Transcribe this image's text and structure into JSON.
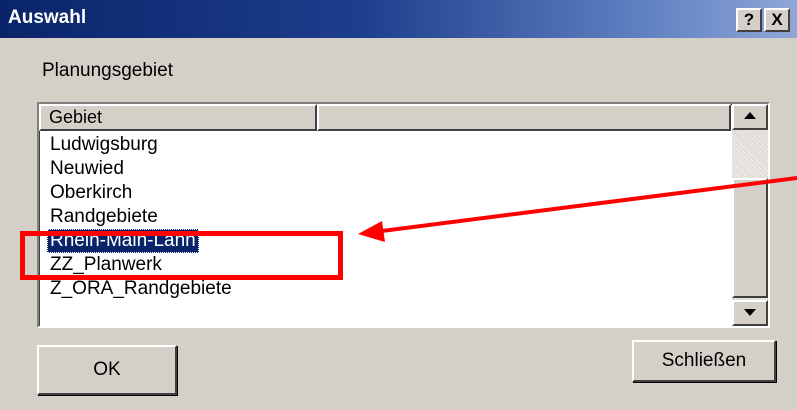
{
  "window": {
    "title": "Auswahl",
    "help_button": "?",
    "close_button": "X"
  },
  "label": "Planungsgebiet",
  "list": {
    "columns": [
      "Gebiet",
      ""
    ],
    "items": [
      "Ludwigsburg",
      "Neuwied",
      "Oberkirch",
      "Randgebiete",
      "Rhein-Main-Lahn",
      "ZZ_Planwerk",
      "Z_ORA_Randgebiete"
    ],
    "selected_index": 4
  },
  "scrollbar": {
    "up_icon": "arrow-up-icon",
    "down_icon": "arrow-down-icon"
  },
  "buttons": {
    "ok": "OK",
    "close": "Schließen"
  },
  "annotation": {
    "color": "#ff0000"
  }
}
